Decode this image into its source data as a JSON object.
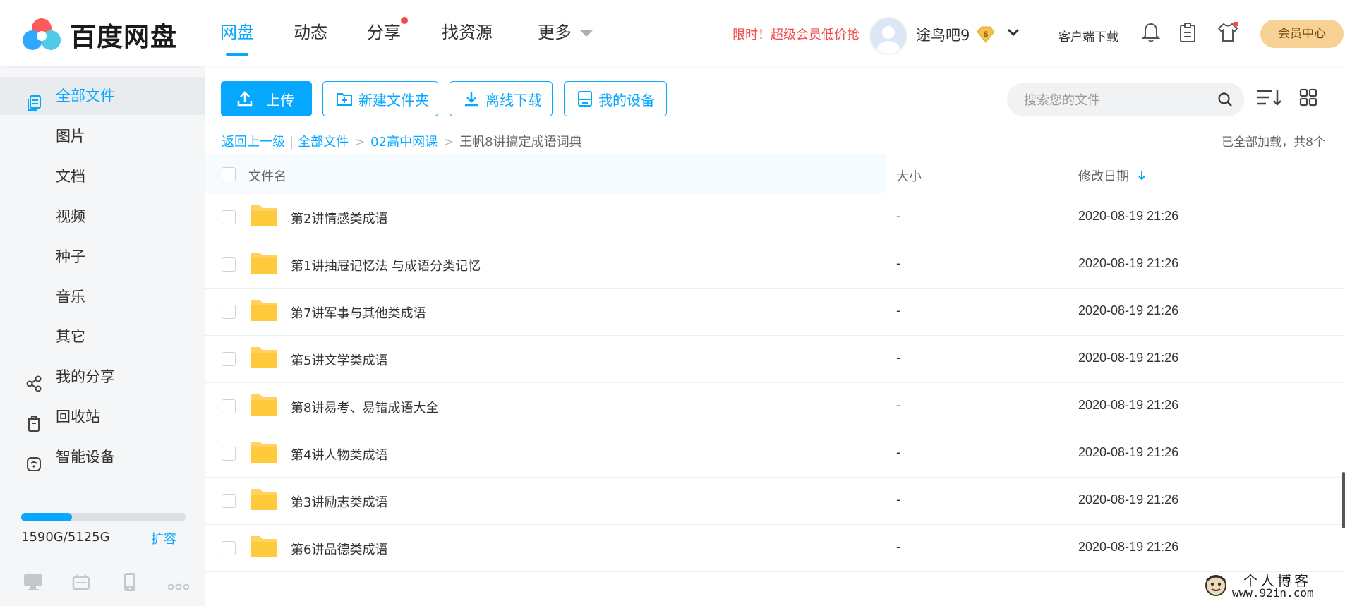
{
  "brand": {
    "name": "百度网盘"
  },
  "nav": [
    {
      "label": "网盘"
    },
    {
      "label": "动态"
    },
    {
      "label": "分享"
    },
    {
      "label": "找资源"
    },
    {
      "label": "更多"
    }
  ],
  "header": {
    "promo": "限时！超级会员低价抢",
    "username": "途鸟吧9",
    "client_download": "客户端下载",
    "vip_center": "会员中心"
  },
  "sidebar": {
    "items": [
      {
        "label": "全部文件"
      },
      {
        "label": "图片"
      },
      {
        "label": "文档"
      },
      {
        "label": "视频"
      },
      {
        "label": "种子"
      },
      {
        "label": "音乐"
      },
      {
        "label": "其它"
      },
      {
        "label": "我的分享"
      },
      {
        "label": "回收站"
      },
      {
        "label": "智能设备"
      }
    ],
    "quota_text": "1590G/5125G",
    "quota_fraction": 0.31,
    "expand": "扩容"
  },
  "toolbar": {
    "upload": "上传",
    "new_folder": "新建文件夹",
    "offline_download": "离线下载",
    "my_devices": "我的设备",
    "search_placeholder": "搜索您的文件"
  },
  "breadcrumb": {
    "back": "返回上一级",
    "items": [
      "全部文件",
      "02高中网课",
      "王帆8讲搞定成语词典"
    ],
    "loaded_text": "已全部加载，共8个"
  },
  "table": {
    "headers": {
      "name": "文件名",
      "size": "大小",
      "date": "修改日期"
    },
    "rows": [
      {
        "name": "第2讲情感类成语",
        "size": "-",
        "date": "2020-08-19 21:26"
      },
      {
        "name": "第1讲抽屉记忆法 与成语分类记忆",
        "size": "-",
        "date": "2020-08-19 21:26"
      },
      {
        "name": "第7讲军事与其他类成语",
        "size": "-",
        "date": "2020-08-19 21:26"
      },
      {
        "name": "第5讲文学类成语",
        "size": "-",
        "date": "2020-08-19 21:26"
      },
      {
        "name": "第8讲易考、易错成语大全",
        "size": "-",
        "date": "2020-08-19 21:26"
      },
      {
        "name": "第4讲人物类成语",
        "size": "-",
        "date": "2020-08-19 21:26"
      },
      {
        "name": "第3讲励志类成语",
        "size": "-",
        "date": "2020-08-19 21:26"
      },
      {
        "name": "第6讲品德类成语",
        "size": "-",
        "date": "2020-08-19 21:26"
      }
    ]
  },
  "watermark": {
    "line1": "个人博客",
    "line2": "www.92in.com"
  },
  "colors": {
    "accent": "#06a7ff",
    "promo": "#f14b4b",
    "vip_bg": "#f8d294",
    "folder": "#ffd35e"
  }
}
